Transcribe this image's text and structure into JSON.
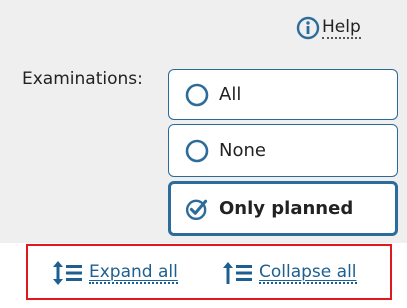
{
  "help": {
    "label": "Help",
    "icon": "info-icon"
  },
  "examinations": {
    "label": "Examinations:",
    "options": [
      {
        "label": "All",
        "selected": false,
        "icon": "radio-empty-icon"
      },
      {
        "label": "None",
        "selected": false,
        "icon": "radio-empty-icon"
      },
      {
        "label": "Only planned",
        "selected": true,
        "icon": "radio-checked-icon"
      }
    ]
  },
  "actions": {
    "expand_label": "Expand all",
    "expand_icon": "expand-all-icon",
    "collapse_label": "Collapse all",
    "collapse_icon": "collapse-all-icon"
  },
  "colors": {
    "accent": "#2c6c9b",
    "link": "#1d5f90",
    "highlight_border": "#e0191f",
    "panel_background": "#efefef"
  }
}
